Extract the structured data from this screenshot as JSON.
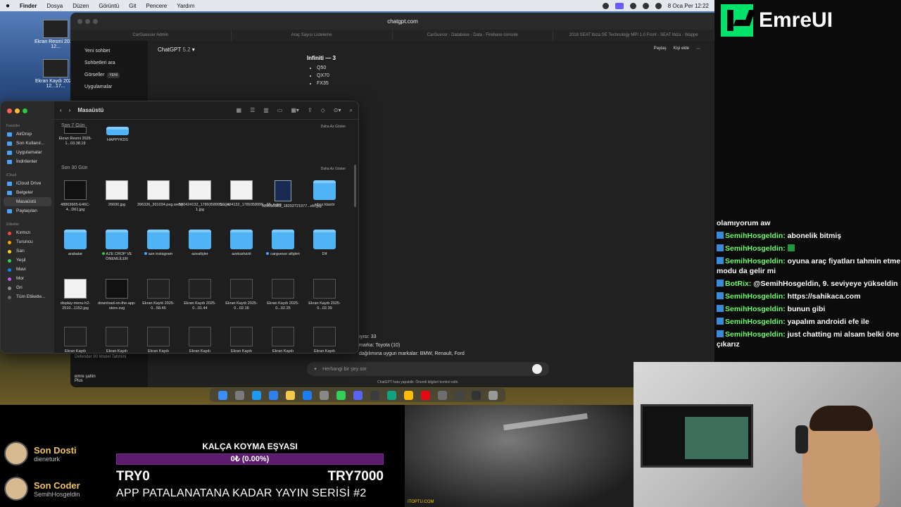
{
  "menubar": {
    "app": "Finder",
    "items": [
      "Dosya",
      "Düzen",
      "Görüntü",
      "Git",
      "Pencere",
      "Yardım"
    ],
    "clock": "8 Oca Per 12:22"
  },
  "desktop": {
    "icons": [
      "Ekran Resmi 2025-12...",
      "Ekran Kaydı 2025-12...17..."
    ]
  },
  "browser": {
    "url": "chatgpt.com",
    "tabs": [
      "CarGuesser Admin",
      "Araç Sayısı Listeleme",
      "CarGuessr - Database - Data - Firebase console",
      "2018 SEAT Ibiza SE Technology MPI 1.0 Front - SEAT Ibiza - Wappe"
    ],
    "model": "ChatGPT",
    "model_version": "5.2",
    "actions": [
      "Paylaş",
      "Kişi ekle"
    ],
    "sidebar": [
      "Yeni sohbet",
      "Sohbetleri ara",
      "Görseller",
      "Uygulamalar"
    ],
    "sidebar_badge": "YENİ",
    "sidebar_chat": "Defender 90 Model Tahmini",
    "user_name": "emre şahin",
    "user_plan": "Plus",
    "answer_title": "Infiniti — 3",
    "answer_items": [
      "Q50",
      "QX70",
      "FX35"
    ],
    "answer_lines": [
      "ıyısı: 33",
      "marka: Toyota (10)",
      "dağılımına uygun markalar: BMW, Renault, Ford"
    ],
    "composer_placeholder": "Herhangi bir şey sor",
    "disclaimer": "ChatGPT hata yapabilir. Önemli bilgileri kontrol edin."
  },
  "finder": {
    "title": "Masaüstü",
    "sidebar": {
      "favorites_label": "Favoriler",
      "favorites": [
        "AirDrop",
        "Son Kullanıl...",
        "Uygulamalar",
        "İndirilenler"
      ],
      "icloud_label": "iCloud",
      "icloud": [
        "iCloud Drive",
        "Belgeler",
        "Masaüstü",
        "Paylaşılan"
      ],
      "tags_label": "Etiketler",
      "tags": [
        {
          "name": "Kırmızı",
          "color": "#ff453a"
        },
        {
          "name": "Turuncu",
          "color": "#ff9f0a"
        },
        {
          "name": "Sarı",
          "color": "#ffd60a"
        },
        {
          "name": "Yeşil",
          "color": "#30d158"
        },
        {
          "name": "Mavi",
          "color": "#0a84ff"
        },
        {
          "name": "Mor",
          "color": "#bf5af2"
        },
        {
          "name": "Gri",
          "color": "#8e8e93"
        },
        {
          "name": "Tüm Etiketle...",
          "color": "#666666"
        }
      ]
    },
    "section7": "Son 7 Gün",
    "section30": "Son 30 Gün",
    "show_less": "Daha Az Göster",
    "row0": [
      "Ekran Resmi 2026-1...03.38.19",
      "HAPPYKDS"
    ],
    "row1": [
      "48863665-E46C-4...D61.jpg",
      "26690.jpg",
      "396326_301034.peg.webp",
      "560424132_1789358995..._n-1.jpg",
      "560424132_1789358995...65_n.jpg",
      "589656883_18202721977...elc.jpg",
      "adsız klasör"
    ],
    "row2": [
      "arabalar",
      "AZE CROP VE ÖNEMLİLER",
      "aze instagram",
      "azeafişler",
      "azekartvizit",
      "carguessr afişleri",
      "Dif"
    ],
    "row3": [
      "display-menu-h2-2510...1152.jpg",
      "download-on-the-app-store.svg",
      "Ekran Kaydı 2025-0...58.45",
      "Ekran Kaydı 2025-0...01.44",
      "Ekran Kaydı 2025-0...02.16",
      "Ekran Kaydı 2025-0...02.25",
      "Ekran Kaydı 2025-0...02.39"
    ],
    "row4": [
      "Ekran Kaydı",
      "Ekran Kaydı",
      "Ekran Kaydı",
      "Ekran Kaydı",
      "Ekran Kaydı",
      "Ekran Kaydı",
      "Ekran Kaydı"
    ]
  },
  "overlay": {
    "brand": "EmreUI",
    "credits": [
      {
        "title": "Son Dosti",
        "name": "dieneturk"
      },
      {
        "title": "Son Coder",
        "name": "SemihHosgeldin"
      }
    ],
    "goal_title": "KALÇA KOYMA EŞYASI",
    "goal_progress": "0₺ (0.00%)",
    "goal_min": "TRY0",
    "goal_max": "TRY7000",
    "series": "APP PATALANATANA KADAR YAYIN SERİSİ #2",
    "game_tag": "ITOPTU.COM"
  },
  "chat": {
    "messages": [
      {
        "user": "",
        "text": "olamıyorum aw"
      },
      {
        "user": "SemihHosgeldin:",
        "text": " abonelik bitmiş"
      },
      {
        "user": "SemihHosgeldin:",
        "text": " "
      },
      {
        "user": "SemihHosgeldin:",
        "text": " oyuna araç fiyatları tahmin etme modu da gelir mi"
      },
      {
        "user": "BotRix:",
        "text": " @SemihHosgeldin, 9. seviyeye yükseldin"
      },
      {
        "user": "SemihHosgeldin:",
        "text": " https://sahikaca.com"
      },
      {
        "user": "SemihHosgeldin:",
        "text": " bunun gibi"
      },
      {
        "user": "SemihHosgeldin:",
        "text": " yapalım androidi efe ile"
      },
      {
        "user": "SemihHosgeldin:",
        "text": " just chatting mi alsam belki öne çıkarız"
      }
    ]
  }
}
